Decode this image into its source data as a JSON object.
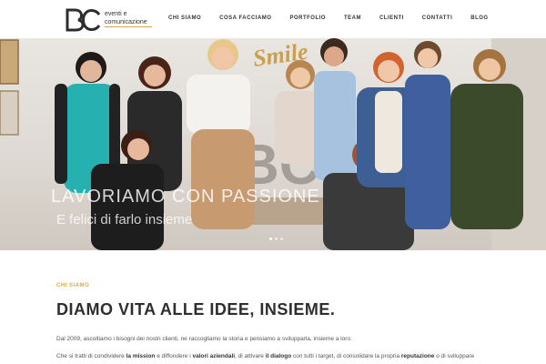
{
  "brand": {
    "logo_lines": [
      "eventi e",
      "comunicazione"
    ],
    "accent_color": "#d9a84a"
  },
  "nav": {
    "items": [
      "CHI SIAMO",
      "COSA FACCIAMO",
      "PORTFOLIO",
      "TEAM",
      "CLIENTI",
      "CONTATTI",
      "BLOG"
    ]
  },
  "hero": {
    "title": "LAVORIAMO CON PASSIONE",
    "subtitle": "E felici di farlo insieme",
    "sign_text": "Smile",
    "slides": 3,
    "active_slide": 1
  },
  "about": {
    "eyebrow": "CHI SIAMO",
    "title": "DIAMO VITA ALLE IDEE, INSIEME.",
    "paragraph1": "Dal 2009, ascoltiamo i bisogni dei nostri clienti, ne raccogliamo la storia e pensiamo a svilupparla, insieme a loro.",
    "paragraph2": {
      "t1": "Che si tratti di condividere ",
      "b1": "la mission",
      "t2": " e diffondere i ",
      "b2": "valori aziendali",
      "t3": ", di attivare ",
      "b3": "il dialogo",
      "t4": " con tutti i target, di consolidare la propria ",
      "b4": "reputazione",
      "t5": " o di sviluppare"
    }
  }
}
